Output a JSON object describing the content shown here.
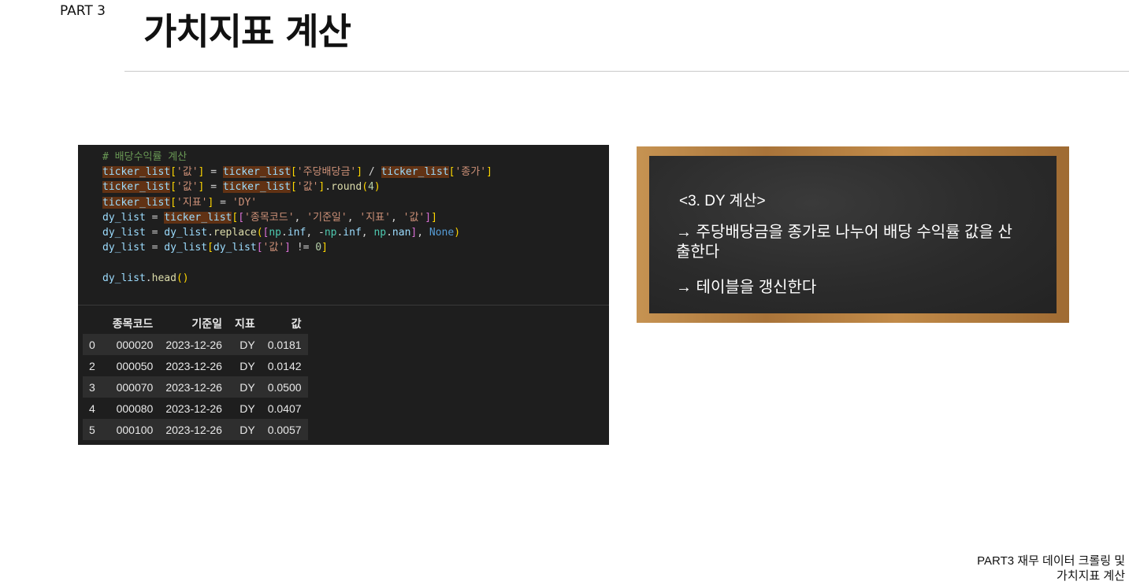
{
  "header": {
    "part": "PART 3",
    "title": "가치지표 계산"
  },
  "code_cell": {
    "lines": [
      "# 배당수익률 계산",
      "ticker_list['값'] = ticker_list['주당배당금'] / ticker_list['종가']",
      "ticker_list['값'] = ticker_list['값'].round(4)",
      "ticker_list['지표'] = 'DY'",
      "dy_list = ticker_list[['종목코드', '기준일', '지표', '값']]",
      "dy_list = dy_list.replace([np.inf, -np.inf, np.nan], None)",
      "dy_list = dy_list[dy_list['값'] != 0]",
      "",
      "dy_list.head()"
    ]
  },
  "table": {
    "columns": [
      "",
      "종목코드",
      "기준일",
      "지표",
      "값"
    ],
    "rows": [
      [
        "0",
        "000020",
        "2023-12-26",
        "DY",
        "0.0181"
      ],
      [
        "2",
        "000050",
        "2023-12-26",
        "DY",
        "0.0142"
      ],
      [
        "3",
        "000070",
        "2023-12-26",
        "DY",
        "0.0500"
      ],
      [
        "4",
        "000080",
        "2023-12-26",
        "DY",
        "0.0407"
      ],
      [
        "5",
        "000100",
        "2023-12-26",
        "DY",
        "0.0057"
      ]
    ]
  },
  "chalkboard": {
    "heading": "<3. DY 계산>",
    "bullets": [
      "→ 주당배당금을 종가로 나누어 배당 수익률 값을 산출한다",
      "→ 테이블을 갱신한다"
    ]
  },
  "footer": {
    "line1": "PART3 재무 데이터 크롤링 및",
    "line2": "가치지표 계산"
  }
}
